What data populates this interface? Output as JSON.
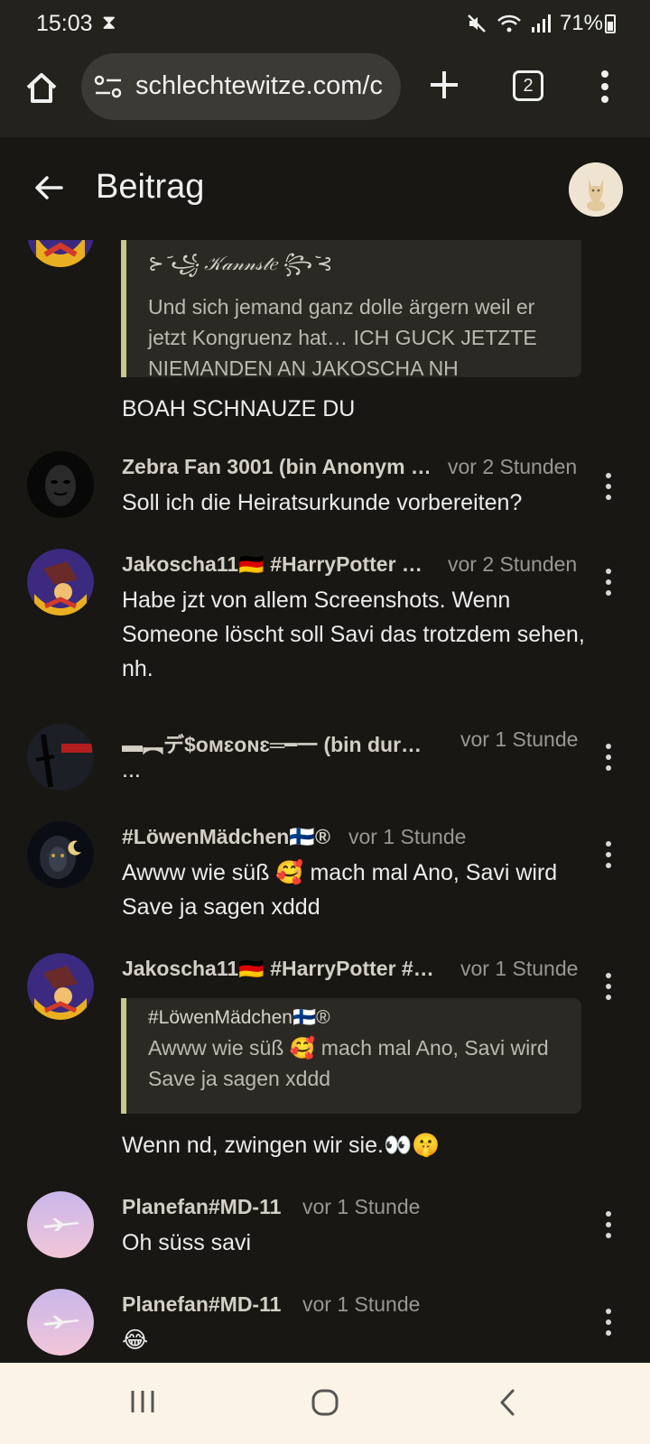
{
  "status_bar": {
    "time": "15:03",
    "battery": "71%"
  },
  "browser": {
    "url": "schlechtewitze.com/c",
    "tab_count": "2"
  },
  "header": {
    "title": "Beitrag"
  },
  "first_comment": {
    "quote_author": "⊱ ᷄꧁ 𝒦𝒶𝓃𝓃𝓈𝓉𝑒 ꧂ ᷅⊰",
    "quote_text": "Und sich jemand ganz dolle ärgern weil er jetzt Kongruenz hat… ICH GUCK JETZTE NIEMANDEN AN JAKOSCHA NH",
    "body": "BOAH SCHNAUZE DU"
  },
  "comments": [
    {
      "author": "Zebra Fan 3001 (bin Anonym …",
      "time": "vor 2 Stunden",
      "body": "Soll ich die Heiratsurkunde vorbereiten?"
    },
    {
      "author": "Jakoscha11🇩🇪 #HarryPotter …",
      "time": "vor 2 Stunden",
      "body": "Habe jzt von allem Screenshots. Wenn Someone löscht soll Savi das trotzdem sehen, nh."
    },
    {
      "author": "▬︻デ$ᴏᴍɛᴏɴɛ═━一 (bin dur…",
      "time": "vor 1 Stunde",
      "body": "..."
    },
    {
      "author": "#LöwenMädchen🇫🇮®",
      "time": "vor 1 Stunde",
      "body": "Awww wie süß 🥰 mach mal Ano, Savi wird Save ja sagen xddd"
    },
    {
      "author": "Jakoscha11🇩🇪 #HarryPotter #…",
      "time": "vor 1 Stunde",
      "quote_author": "#LöwenMädchen🇫🇮®",
      "quote_text": "Awww wie süß 🥰 mach mal Ano, Savi wird Save ja sagen xddd",
      "body": "Wenn nd, zwingen wir sie.👀🤫"
    },
    {
      "author": "Planefan#MD-11",
      "time": "vor 1 Stunde",
      "body": "Oh süss savi"
    },
    {
      "author": "Planefan#MD-11",
      "time": "vor 1 Stunde",
      "body": "😂"
    }
  ],
  "icons": {
    "home": "home-icon",
    "site_settings": "site-settings-icon",
    "new_tab": "plus-icon",
    "tabs": "tabs-icon",
    "menu": "more-vert-icon",
    "back": "arrow-back-icon",
    "recents": "recents-icon",
    "home_nav": "home-circle-icon",
    "back_nav": "chevron-left-icon"
  },
  "colors": {
    "background": "#181713",
    "quote_bar": "#c9c88a",
    "author": "#d3cfc5",
    "time": "#9a9790"
  }
}
